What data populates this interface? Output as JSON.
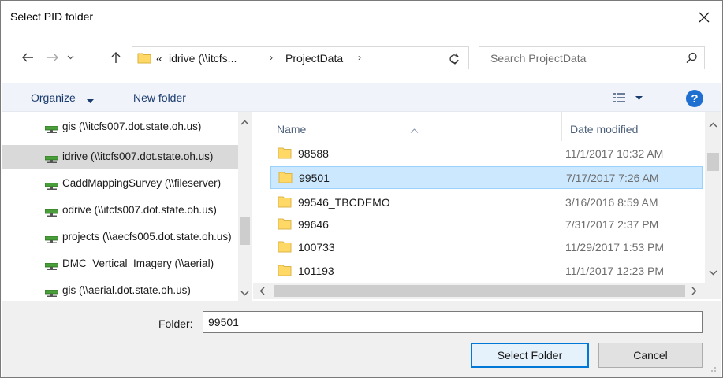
{
  "window": {
    "title": "Select PID folder"
  },
  "address": {
    "crumb_prefix": "«",
    "crumb_1": "idrive (\\\\itcfs...",
    "crumb_2": "ProjectData",
    "sep": "›"
  },
  "search": {
    "placeholder": "Search ProjectData"
  },
  "toolbar": {
    "organize": "Organize",
    "new_folder": "New folder",
    "help": "?"
  },
  "nav": {
    "items": [
      {
        "label": "gis (\\\\itcfs007.dot.state.oh.us)"
      },
      {
        "label": "idrive (\\\\itcfs007.dot.state.oh.us)"
      },
      {
        "label": "CaddMappingSurvey (\\\\fileserver)"
      },
      {
        "label": "odrive (\\\\itcfs007.dot.state.oh.us)"
      },
      {
        "label": "projects (\\\\aecfs005.dot.state.oh.us)"
      },
      {
        "label": "DMC_Vertical_Imagery (\\\\aerial)"
      },
      {
        "label": "gis (\\\\aerial.dot.state.oh.us)"
      }
    ],
    "selected_index": 1
  },
  "columns": {
    "name": "Name",
    "date": "Date modified"
  },
  "files": [
    {
      "name": "98588",
      "date": "11/1/2017 10:32 AM"
    },
    {
      "name": "99501",
      "date": "7/17/2017 7:26 AM"
    },
    {
      "name": "99546_TBCDEMO",
      "date": "3/16/2016 8:59 AM"
    },
    {
      "name": "99646",
      "date": "7/31/2017 2:37 PM"
    },
    {
      "name": "100733",
      "date": "11/29/2017 1:53 PM"
    },
    {
      "name": "101193",
      "date": "11/1/2017 12:23 PM"
    }
  ],
  "selected_file_index": 1,
  "footer": {
    "folder_label": "Folder:",
    "folder_value": "99501",
    "select_button": "Select Folder",
    "cancel_button": "Cancel"
  },
  "colors": {
    "accent": "#0078d7",
    "selected_row": "#cce8ff",
    "folder": "#ffd866"
  }
}
